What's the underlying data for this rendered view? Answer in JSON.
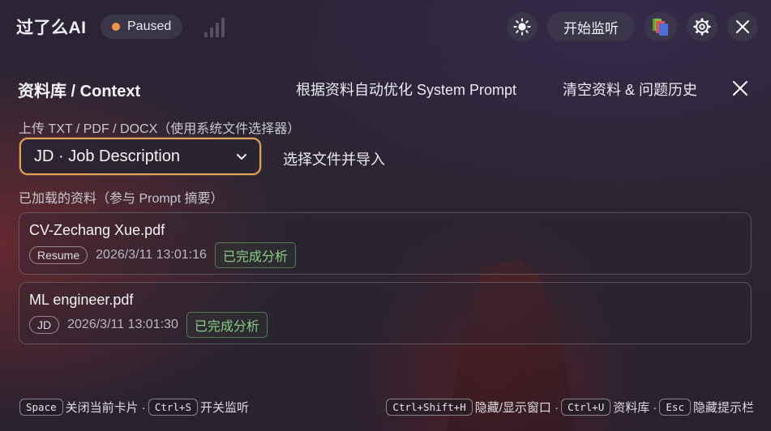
{
  "app": {
    "title": "过了么AI",
    "status": "Paused",
    "status_color": "#f0954a"
  },
  "toolbar": {
    "theme_icon": "sun-icon",
    "start_label": "开始监听",
    "library_icon": "books-icon",
    "settings_icon": "gear-icon",
    "close_icon": "close-icon"
  },
  "panel": {
    "title": "资料库 / Context",
    "optimize_label": "根据资料自动优化 System Prompt",
    "clear_label": "清空资料 & 问题历史",
    "upload_label": "上传 TXT / PDF / DOCX（使用系统文件选择器）",
    "doc_type_selected": "JD · Job Description",
    "import_label": "选择文件并导入",
    "loaded_label": "已加载的资料（参与 Prompt 摘要）",
    "files": [
      {
        "name": "CV-Zechang Xue.pdf",
        "tag": "Resume",
        "timestamp": "2026/3/11 13:01:16",
        "status": "已完成分析"
      },
      {
        "name": "ML engineer.pdf",
        "tag": "JD",
        "timestamp": "2026/3/11 13:01:30",
        "status": "已完成分析"
      }
    ]
  },
  "footer": {
    "key_space": "Space",
    "text_close_card": "关闭当前卡片 ·",
    "key_ctrl_s": "Ctrl+S",
    "text_toggle_listen": "开关监听",
    "key_ctrl_shift_h": "Ctrl+Shift+H",
    "text_hide_window": "隐藏/显示窗口 ·",
    "key_ctrl_u": "Ctrl+U",
    "text_library": "资料库 ·",
    "key_esc": "Esc",
    "text_hide_hints": "隐藏提示栏"
  },
  "colors": {
    "accent_border": "#e0a453",
    "success": "#86cc86"
  }
}
